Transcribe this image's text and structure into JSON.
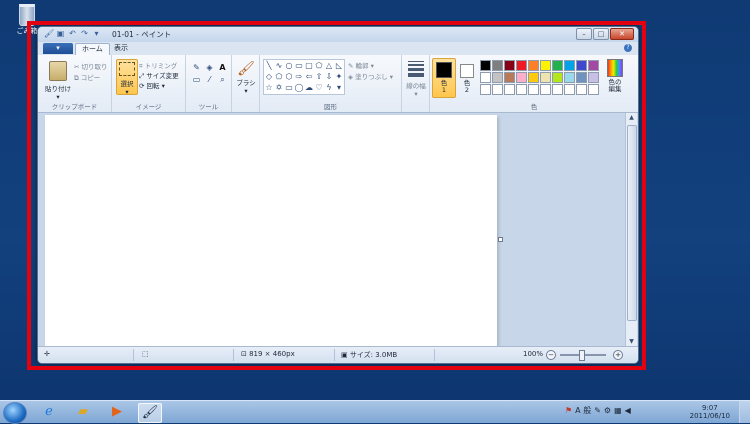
{
  "desktop": {
    "recycle_label": "ごみ箱"
  },
  "window": {
    "title": "01-01 - ペイント",
    "app_menu_label": "▾",
    "tabs": [
      {
        "label": "ホーム"
      },
      {
        "label": "表示"
      }
    ],
    "help_label": "?",
    "min_label": "–",
    "max_label": "□",
    "close_label": "✕"
  },
  "ribbon": {
    "clipboard": {
      "group_label": "クリップボード",
      "paste": "貼り付け",
      "cut": "切り取り",
      "copy": "コピー"
    },
    "image": {
      "group_label": "イメージ",
      "select": "選択",
      "crop": "トリミング",
      "resize": "サイズ変更",
      "rotate": "回転"
    },
    "tools": {
      "group_label": "ツール",
      "text_tool": "A"
    },
    "brushes": {
      "label": "ブラシ"
    },
    "shapes": {
      "group_label": "図形",
      "outline": "輪郭",
      "fill": "塗りつぶし"
    },
    "size": {
      "label": "線の幅"
    },
    "colors": {
      "group_label": "色",
      "color1": "色\n1",
      "color1_a": "色",
      "color1_b": "1",
      "color2_a": "色",
      "color2_b": "2",
      "edit_a": "色の",
      "edit_b": "編集",
      "palette": [
        "#000000",
        "#7f7f7f",
        "#880015",
        "#ed1c24",
        "#ff7f27",
        "#fff200",
        "#22b14c",
        "#00a2e8",
        "#3f48cc",
        "#a349a4",
        "#ffffff",
        "#c3c3c3",
        "#b97a57",
        "#ffaec9",
        "#ffc90e",
        "#efe4b0",
        "#b5e61d",
        "#99d9ea",
        "#7092be",
        "#c8bfe7",
        "#ffffff",
        "#ffffff",
        "#ffffff",
        "#ffffff",
        "#ffffff",
        "#ffffff",
        "#ffffff",
        "#ffffff",
        "#ffffff",
        "#ffffff"
      ]
    }
  },
  "statusbar": {
    "dimensions": "819 × 460px",
    "filesize": "サイズ: 3.0MB",
    "zoom": "100%"
  },
  "taskbar": {
    "time": "9:07",
    "date": "2011/06/10",
    "ime": "A 般"
  }
}
